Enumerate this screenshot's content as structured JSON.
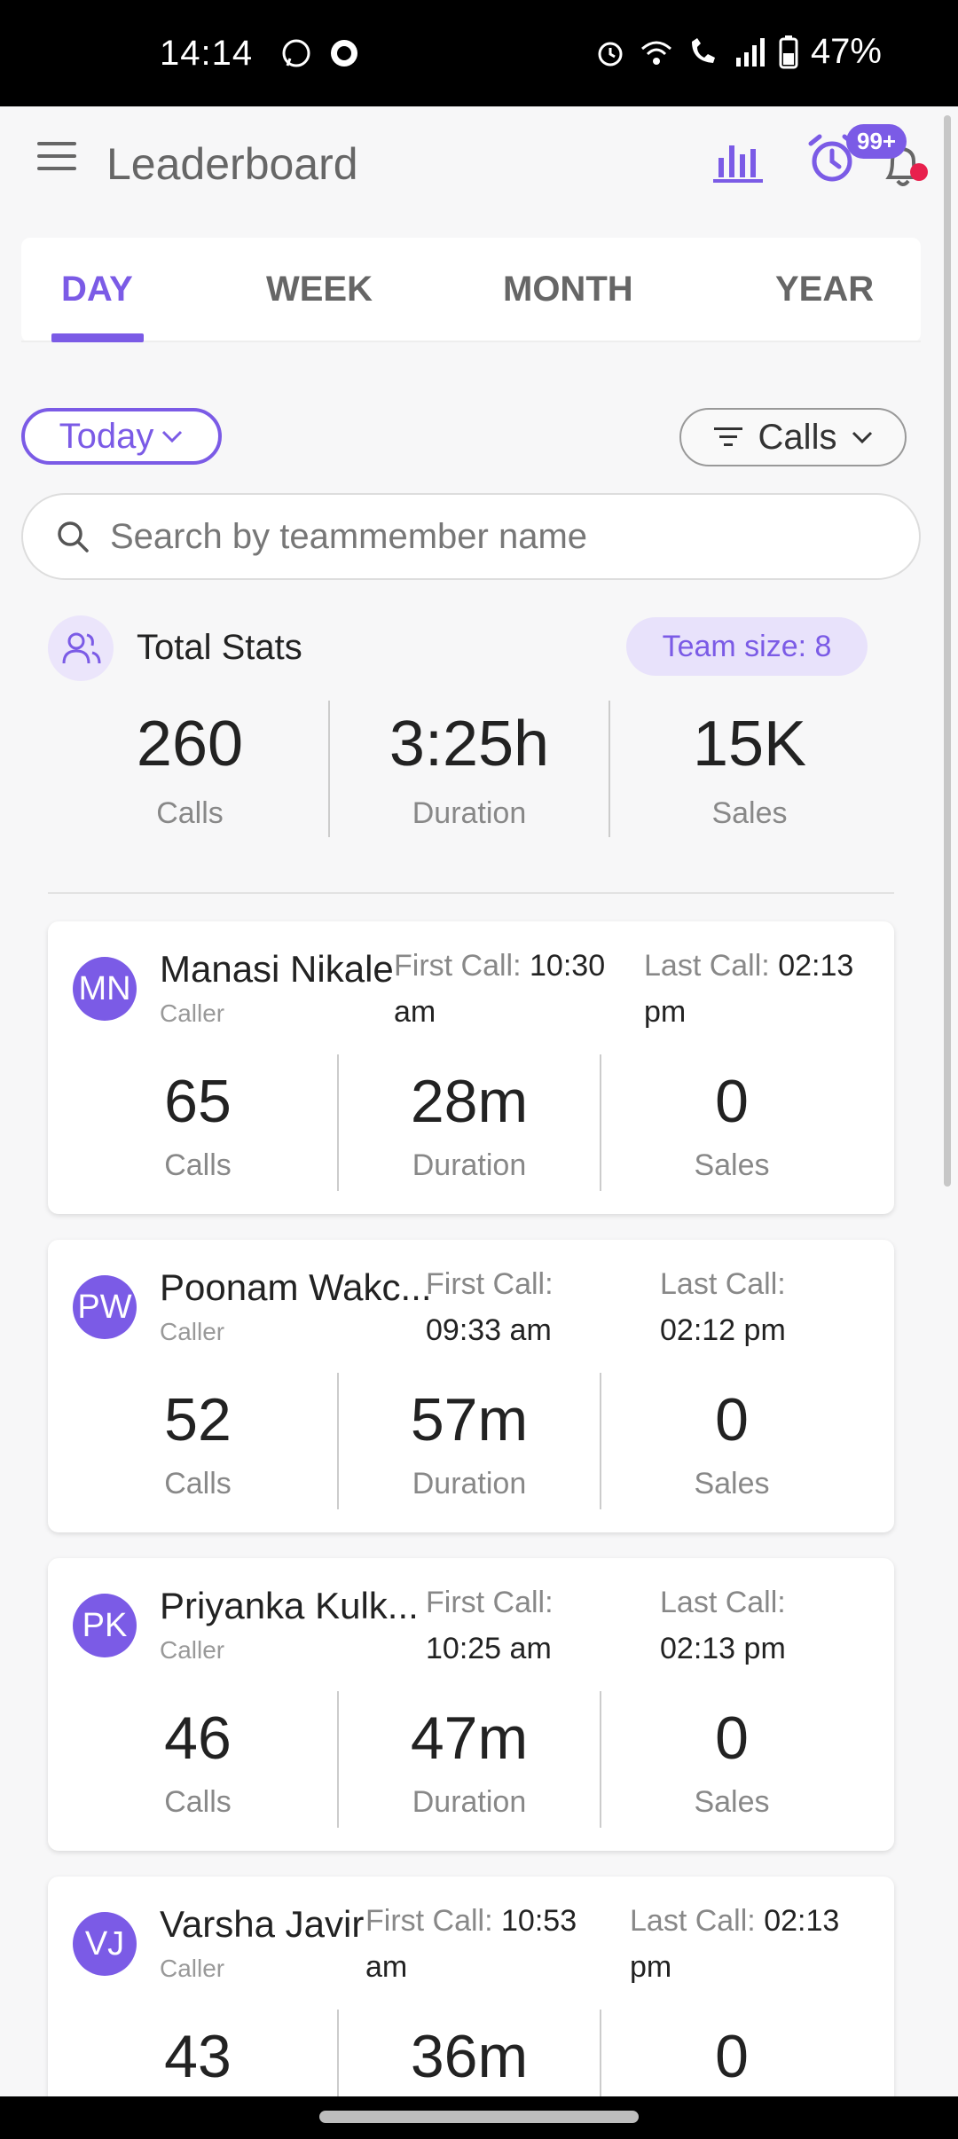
{
  "status_bar": {
    "time": "14:14",
    "battery": "47%"
  },
  "appbar": {
    "title": "Leaderboard",
    "badge": "99+"
  },
  "tabs": [
    {
      "label": "DAY"
    },
    {
      "label": "WEEK"
    },
    {
      "label": "MONTH"
    },
    {
      "label": "YEAR"
    }
  ],
  "filters": {
    "period": "Today",
    "metric": "Calls"
  },
  "search": {
    "placeholder": "Search by teammember name"
  },
  "total_stats": {
    "title": "Total Stats",
    "team_size": "Team size: 8",
    "calls": "260",
    "calls_label": "Calls",
    "duration": "3:25h",
    "duration_label": "Duration",
    "sales": "15K",
    "sales_label": "Sales"
  },
  "members": [
    {
      "initials": "MN",
      "name": "Manasi Nikale",
      "role": "Caller",
      "first_call_label": "First Call:",
      "first_call_line1": "10:30",
      "first_call_line2": "am",
      "last_call_label": "Last Call:",
      "last_call_line1": "02:13",
      "last_call_line2": "pm",
      "calls": "65",
      "duration": "28m",
      "sales": "0"
    },
    {
      "initials": "PW",
      "name": "Poonam Wakc...",
      "role": "Caller",
      "first_call_label": "First Call:",
      "first_call_line1": "",
      "first_call_line2": "09:33 am",
      "last_call_label": "Last Call:",
      "last_call_line1": "",
      "last_call_line2": "02:12 pm",
      "calls": "52",
      "duration": "57m",
      "sales": "0"
    },
    {
      "initials": "PK",
      "name": "Priyanka Kulk...",
      "role": "Caller",
      "first_call_label": "First Call:",
      "first_call_line1": "",
      "first_call_line2": "10:25 am",
      "last_call_label": "Last Call:",
      "last_call_line1": "",
      "last_call_line2": "02:13 pm",
      "calls": "46",
      "duration": "47m",
      "sales": "0"
    },
    {
      "initials": "VJ",
      "name": "Varsha Javir",
      "role": "Caller",
      "first_call_label": "First Call:",
      "first_call_line1": "10:53",
      "first_call_line2": "am",
      "last_call_label": "Last Call:",
      "last_call_line1": "02:13",
      "last_call_line2": "pm",
      "calls": "43",
      "duration": "36m",
      "sales": "0"
    }
  ],
  "labels": {
    "calls": "Calls",
    "duration": "Duration",
    "sales": "Sales"
  },
  "colors": {
    "accent": "#7b5be6",
    "notification": "#e8204d"
  }
}
